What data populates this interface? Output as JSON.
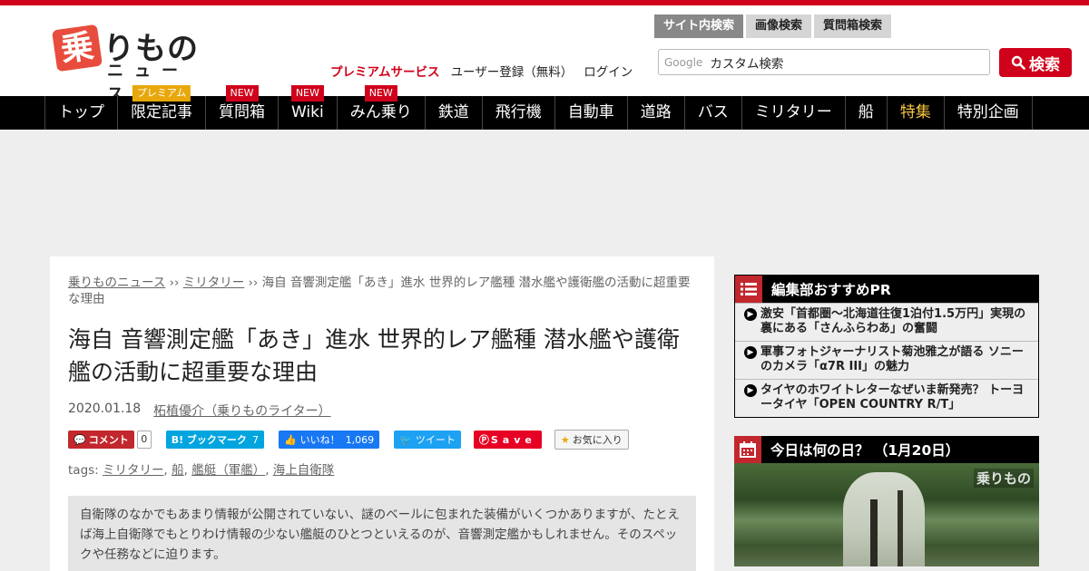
{
  "site": {
    "logo_badge": "乗",
    "logo_main": "りもの",
    "logo_sub": "ニュース",
    "brand_color": "#d0021b"
  },
  "header": {
    "premium": "プレミアムサービス",
    "register": "ユーザー登録（無料）",
    "login": "ログイン"
  },
  "search": {
    "tabs": [
      "サイト内検索",
      "画像検索",
      "質問箱検索"
    ],
    "google_label": "Google",
    "placeholder": "カスタム検索",
    "button": "検索"
  },
  "nav": {
    "items": [
      {
        "label": "トップ",
        "badge": ""
      },
      {
        "label": "限定記事",
        "badge": "プレミアム"
      },
      {
        "label": "質問箱",
        "badge": "NEW"
      },
      {
        "label": "Wiki",
        "badge": "NEW"
      },
      {
        "label": "みん乗り",
        "badge": "NEW"
      },
      {
        "label": "鉄道",
        "badge": ""
      },
      {
        "label": "飛行機",
        "badge": ""
      },
      {
        "label": "自動車",
        "badge": ""
      },
      {
        "label": "道路",
        "badge": ""
      },
      {
        "label": "バス",
        "badge": ""
      },
      {
        "label": "ミリタリー",
        "badge": ""
      },
      {
        "label": "船",
        "badge": ""
      },
      {
        "label": "特集",
        "badge": ""
      },
      {
        "label": "特別企画",
        "badge": ""
      }
    ]
  },
  "article": {
    "breadcrumb": {
      "home": "乗りものニュース",
      "sep": " ›› ",
      "category": "ミリタリー",
      "current": "海自 音響測定艦「あき」進水 世界的レア艦種 潜水艦や護衛艦の活動に超重要な理由"
    },
    "title": "海自 音響測定艦「あき」進水 世界的レア艦種 潜水艦や護衛艦の活動に超重要な理由",
    "date": "2020.01.18",
    "author": "柘植優介（乗りものライター）",
    "share": {
      "comment": "コメント",
      "comment_count": "0",
      "hatena": "B! ブックマーク",
      "hatena_count": "7",
      "like": "いいね！",
      "like_count": "1,069",
      "tweet": "ツイート",
      "save": "Save",
      "favorite": "お気に入り"
    },
    "tags_label": "tags:",
    "tags": [
      "ミリタリー",
      "船",
      "艦艇（軍艦）",
      "海上自衛隊"
    ],
    "lead": "自衛隊のなかでもあまり情報が公開されていない、謎のベールに包まれた装備がいくつかありますが、たとえば海上自衛隊でもとりわけ情報の少ない艦艇のひとつといえるのが、音響測定艦かもしれません。そのスペックや任務などに迫ります。"
  },
  "sidebar": {
    "recommend_title": "編集部おすすめPR",
    "recommend": [
      "激安「首都圏～北海道往復1泊付1.5万円」実現の裏にある「さんふらわあ」の奮闘",
      "軍事フォトジャーナリスト菊池雅之が語る ソニーのカメラ「α7R III」の魅力",
      "タイヤのホワイトレターなぜいま新発売？ トーヨータイヤ「OPEN COUNTRY R/T」"
    ],
    "today_title": "今日は何の日？ （1月20日）",
    "today_watermark": "乗りもの"
  }
}
